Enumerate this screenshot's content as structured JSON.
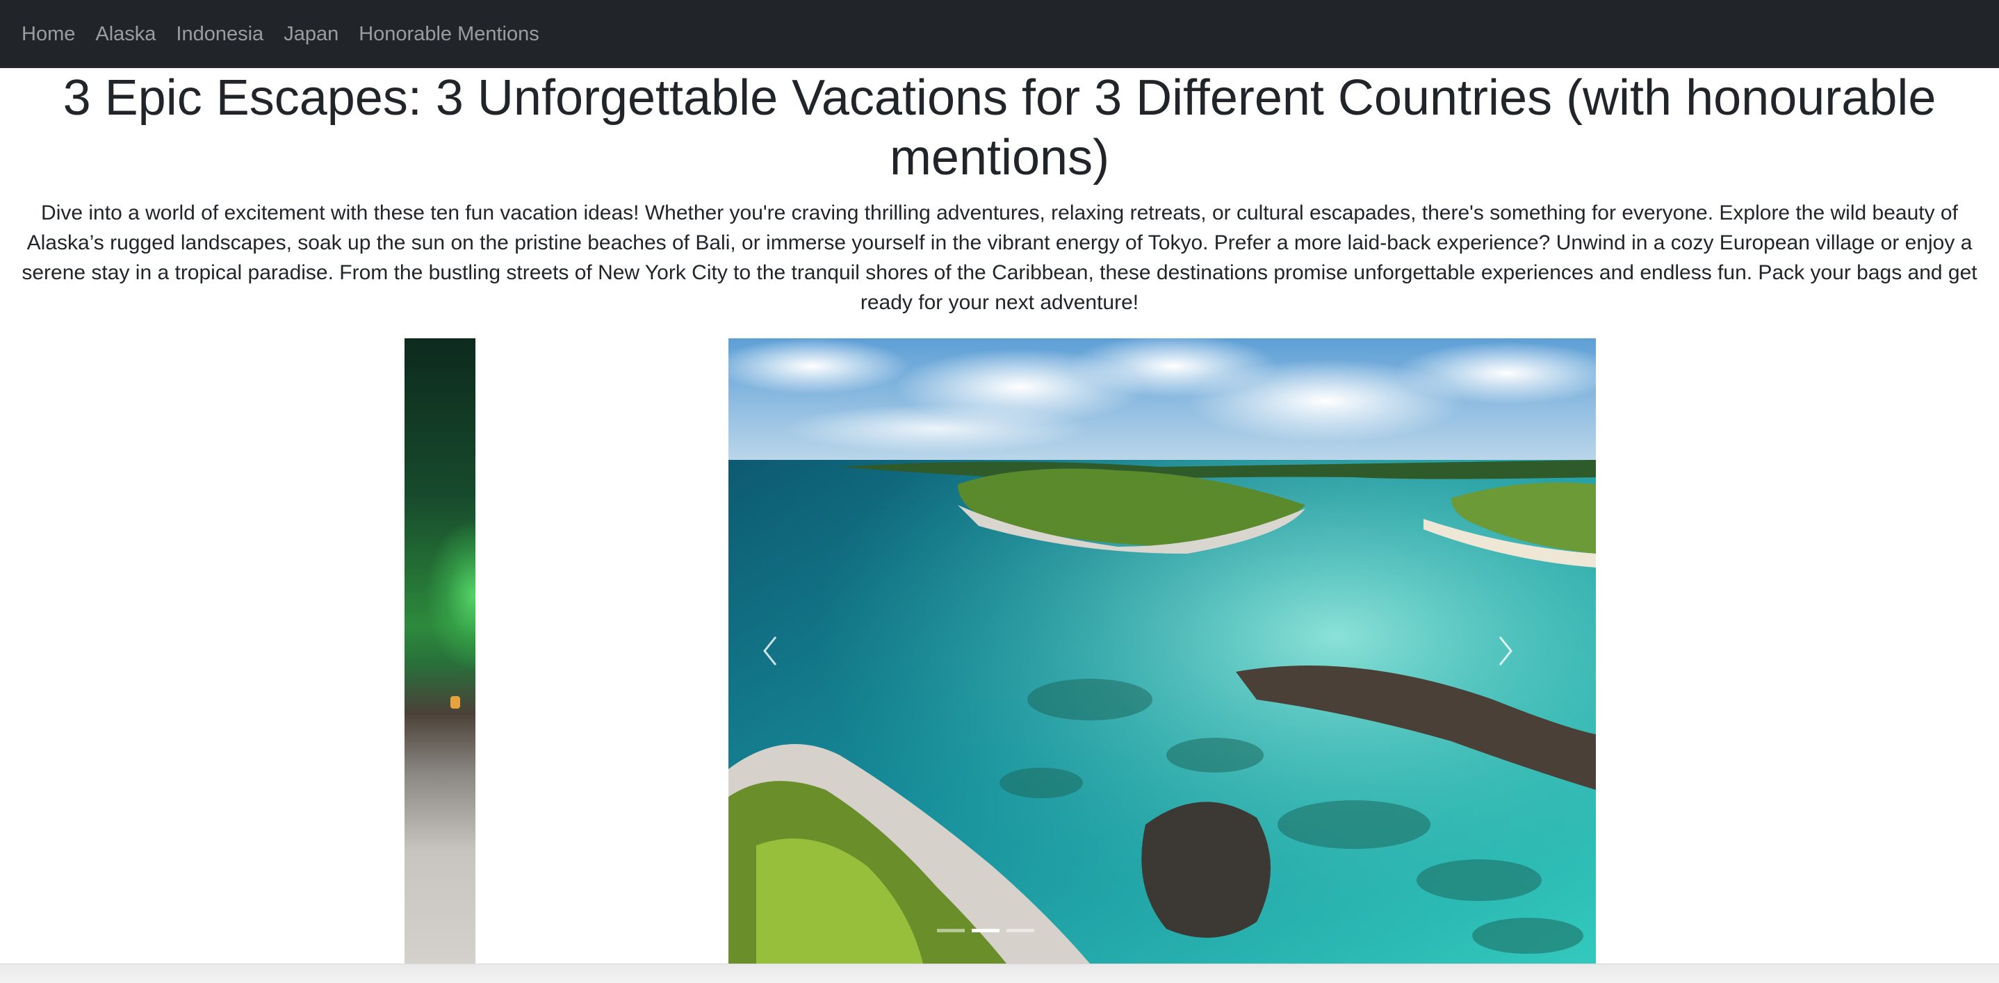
{
  "nav": {
    "links": [
      "Home",
      "Alaska",
      "Indonesia",
      "Japan",
      "Honorable Mentions"
    ]
  },
  "page": {
    "title": "3 Epic Escapes: 3 Unforgettable Vacations for 3 Different Countries (with honourable mentions)",
    "intro": "Dive into a world of excitement with these ten fun vacation ideas! Whether you're craving thrilling adventures, relaxing retreats, or cultural escapades, there's something for everyone. Explore the wild beauty of Alaska’s rugged landscapes, soak up the sun on the pristine beaches of Bali, or immerse yourself in the vibrant energy of Tokyo. Prefer a more laid-back experience? Unwind in a cozy European village or enjoy a serene stay in a tropical paradise. From the bustling streets of New York City to the tranquil shores of the Caribbean, these destinations promise unforgettable experiences and endless fun. Pack your bags and get ready for your next adventure!"
  },
  "carousel": {
    "active_index": 1,
    "slide_count": 3,
    "prev_icon": "chevron-left-icon",
    "next_icon": "chevron-right-icon",
    "colors": {
      "sea": "#1fb8b0",
      "deep_sea": "#0e5c72",
      "sky": "#6aa6d6",
      "vegetation": "#6f9a2e"
    }
  }
}
